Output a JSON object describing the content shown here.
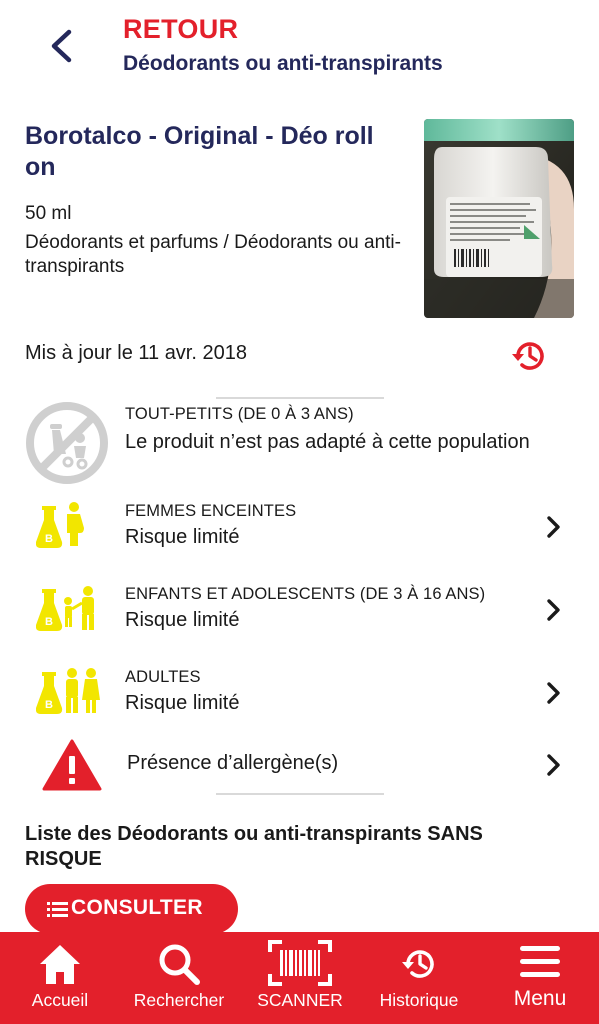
{
  "header": {
    "back_label": "RETOUR",
    "category_title": "Déodorants ou anti-transpirants"
  },
  "product": {
    "name": "Borotalco - Original - Déo roll on",
    "quantity": "50 ml",
    "category_path": "Déodorants et parfums / Déodorants ou anti-transpirants",
    "updated": "Mis à jour le 11 avr. 2018"
  },
  "risks": [
    {
      "group": "TOUT-PETITS (DE 0 À 3 ANS)",
      "status": "Le produit n’est pas adapté à cette population",
      "icon": "not-suitable-baby-icon"
    },
    {
      "group": "FEMMES ENCEINTES",
      "status": "Risque limité",
      "icon": "flask-pregnant-woman-icon"
    },
    {
      "group": "ENFANTS ET ADOLESCENTS (DE 3 À 16 ANS)",
      "status": "Risque limité",
      "icon": "flask-children-icon"
    },
    {
      "group": "ADULTES",
      "status": "Risque limité",
      "icon": "flask-adults-icon"
    }
  ],
  "allergen": {
    "label": "Présence d’allergène(s)",
    "icon": "warning-triangle-icon"
  },
  "list": {
    "title": "Liste des Déodorants ou anti-transpirants SANS RISQUE",
    "button_label": "CONSULTER"
  },
  "nav": [
    {
      "label": "Accueil",
      "icon": "home-icon"
    },
    {
      "label": "Rechercher",
      "icon": "search-icon"
    },
    {
      "label": "SCANNER",
      "icon": "barcode-scanner-icon"
    },
    {
      "label": "Historique",
      "icon": "history-icon"
    },
    {
      "label": "Menu",
      "icon": "menu-icon"
    }
  ],
  "colors": {
    "accent_red": "#e3202b",
    "title_navy": "#24285b",
    "limited_risk_yellow": "#f2e600",
    "disabled_gray": "#cfcfcf"
  }
}
